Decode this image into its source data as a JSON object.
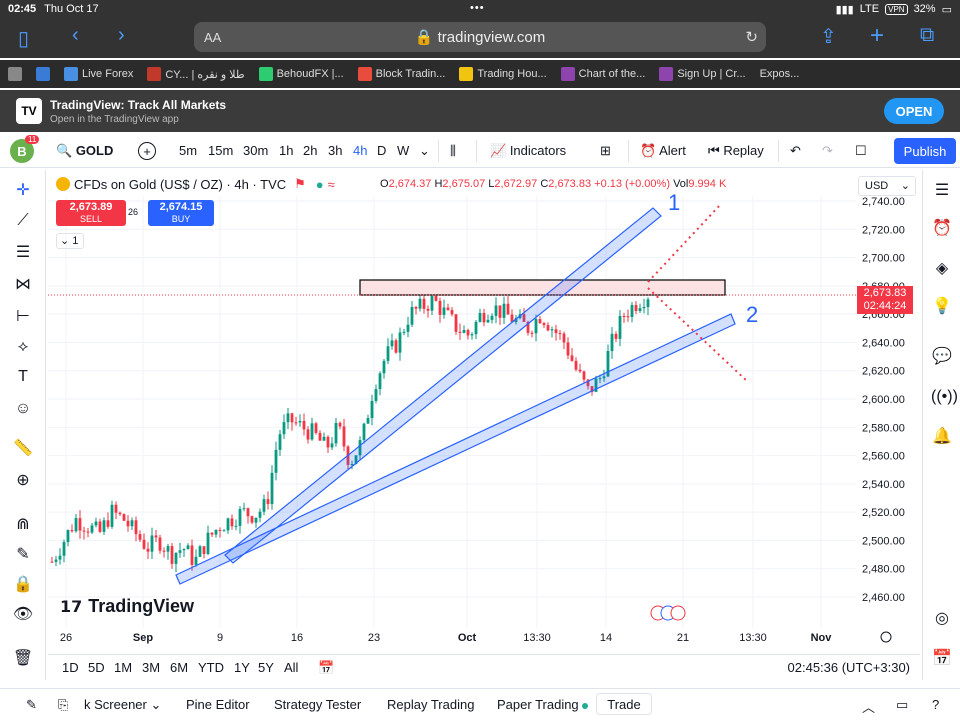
{
  "status_bar": {
    "time": "02:45",
    "date": "Thu Oct 17",
    "network": "LTE",
    "vpn": "VPN",
    "battery": "32%"
  },
  "browser": {
    "aa": "AA",
    "url": "tradingview.com"
  },
  "bookmarks": [
    {
      "label": "",
      "icon": "tv-favicon"
    },
    {
      "label": "",
      "icon": "bookmark-favicon"
    },
    {
      "label": "Live Forex",
      "icon": "forex-favicon"
    },
    {
      "label": "CY... | طلا و نقره",
      "icon": "cy-favicon"
    },
    {
      "label": "BehoudFX |...",
      "icon": "behoud-favicon"
    },
    {
      "label": "Block Tradin...",
      "icon": "block-favicon"
    },
    {
      "label": "Trading Hou...",
      "icon": "house-favicon"
    },
    {
      "label": "Chart of the...",
      "icon": "chart-favicon"
    },
    {
      "label": "Sign Up | Cr...",
      "icon": "signup-favicon"
    },
    {
      "label": "Expos...",
      "icon": "none"
    }
  ],
  "app_banner": {
    "logo": "TV",
    "title": "TradingView: Track All Markets",
    "subtitle": "Open in the TradingView app",
    "open": "OPEN"
  },
  "toolbar": {
    "avatar": "B",
    "notifications": "11",
    "symbol": "GOLD",
    "timeframes": [
      "5m",
      "15m",
      "30m",
      "1h",
      "2h",
      "3h",
      "4h",
      "D",
      "W"
    ],
    "active_timeframe": "4h",
    "indicators": "Indicators",
    "alert": "Alert",
    "replay": "Replay",
    "publish": "Publish"
  },
  "legend": {
    "title": "CFDs on Gold (US$ / OZ) · 4h · TVC",
    "O": "2,674.37",
    "H": "2,675.07",
    "L": "2,672.97",
    "C": "2,673.83",
    "change": "+0.13 (+0.00%)",
    "vol_label": "Vol",
    "vol": "9.994 K"
  },
  "trade": {
    "sell_price": "2,673.89",
    "sell_label": "SELL",
    "spread": "26",
    "buy_price": "2,674.15",
    "buy_label": "BUY",
    "collapse": "1"
  },
  "currency": "USD",
  "price_tag": {
    "price": "2,673.83",
    "countdown": "02:44:24"
  },
  "annotations": {
    "label1": "1",
    "label2": "2"
  },
  "chart_data": {
    "type": "candlestick",
    "symbol": "GOLD",
    "timeframe": "4h",
    "y_ticks": [
      "2,740.00",
      "2,720.00",
      "2,700.00",
      "2,680.00",
      "2,660.00",
      "2,640.00",
      "2,620.00",
      "2,600.00",
      "2,580.00",
      "2,560.00",
      "2,540.00",
      "2,520.00",
      "2,500.00",
      "2,480.00",
      "2,460.00"
    ],
    "x_ticks": [
      "26",
      "Sep",
      "9",
      "16",
      "23",
      "Oct",
      "13:30",
      "14",
      "21",
      "13:30",
      "Nov"
    ],
    "ylim": [
      2452,
      2745
    ],
    "current_price": 2673.83,
    "close_path": [
      2485,
      2500,
      2515,
      2510,
      2505,
      2520,
      2515,
      2505,
      2495,
      2500,
      2490,
      2495,
      2485,
      2500,
      2510,
      2515,
      2520,
      2518,
      2525,
      2575,
      2585,
      2580,
      2575,
      2565,
      2580,
      2555,
      2570,
      2610,
      2630,
      2640,
      2660,
      2665,
      2670,
      2660,
      2650,
      2645,
      2660,
      2665,
      2660,
      2655,
      2650,
      2660,
      2650,
      2640,
      2620,
      2605,
      2615,
      2640,
      2660,
      2668,
      2674
    ]
  },
  "range_bar": {
    "ranges": [
      "1D",
      "5D",
      "1M",
      "3M",
      "6M",
      "YTD",
      "1Y",
      "5Y",
      "All"
    ],
    "clock": "02:45:36 (UTC+3:30)"
  },
  "footer": {
    "screener": "k Screener",
    "pine": "Pine Editor",
    "tester": "Strategy Tester",
    "replay": "Replay Trading",
    "paper": "Paper Trading",
    "trade": "Trade"
  },
  "logo_text": "TradingView"
}
